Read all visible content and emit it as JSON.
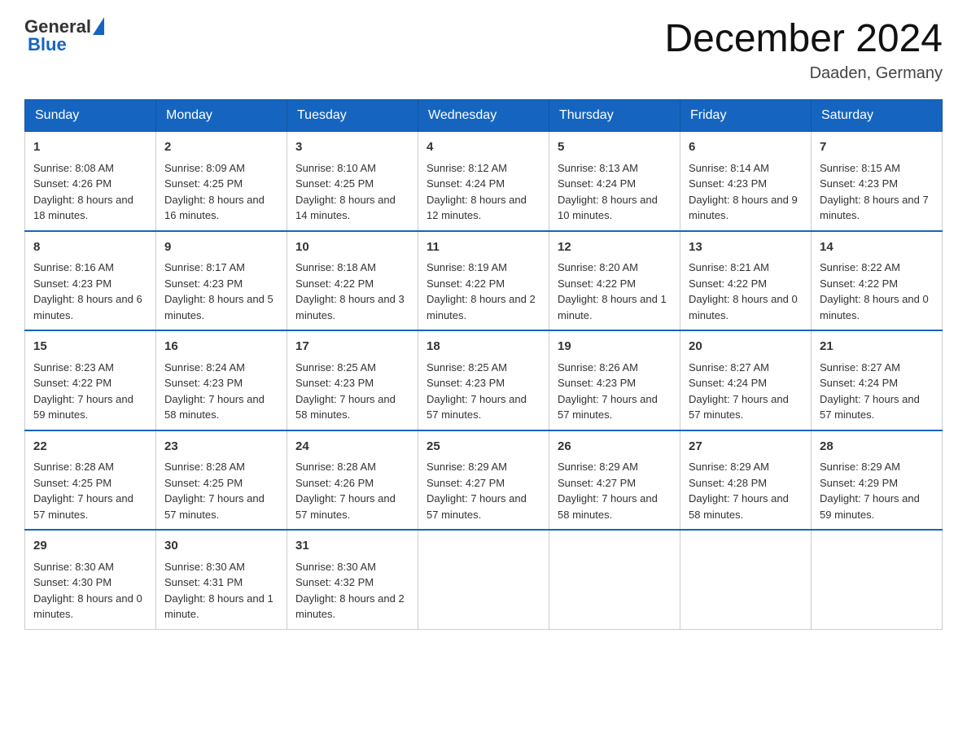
{
  "header": {
    "logo": {
      "general": "General",
      "blue": "Blue"
    },
    "title": "December 2024",
    "location": "Daaden, Germany"
  },
  "weekdays": [
    "Sunday",
    "Monday",
    "Tuesday",
    "Wednesday",
    "Thursday",
    "Friday",
    "Saturday"
  ],
  "weeks": [
    [
      {
        "day": "1",
        "sunrise": "8:08 AM",
        "sunset": "4:26 PM",
        "daylight": "8 hours and 18 minutes."
      },
      {
        "day": "2",
        "sunrise": "8:09 AM",
        "sunset": "4:25 PM",
        "daylight": "8 hours and 16 minutes."
      },
      {
        "day": "3",
        "sunrise": "8:10 AM",
        "sunset": "4:25 PM",
        "daylight": "8 hours and 14 minutes."
      },
      {
        "day": "4",
        "sunrise": "8:12 AM",
        "sunset": "4:24 PM",
        "daylight": "8 hours and 12 minutes."
      },
      {
        "day": "5",
        "sunrise": "8:13 AM",
        "sunset": "4:24 PM",
        "daylight": "8 hours and 10 minutes."
      },
      {
        "day": "6",
        "sunrise": "8:14 AM",
        "sunset": "4:23 PM",
        "daylight": "8 hours and 9 minutes."
      },
      {
        "day": "7",
        "sunrise": "8:15 AM",
        "sunset": "4:23 PM",
        "daylight": "8 hours and 7 minutes."
      }
    ],
    [
      {
        "day": "8",
        "sunrise": "8:16 AM",
        "sunset": "4:23 PM",
        "daylight": "8 hours and 6 minutes."
      },
      {
        "day": "9",
        "sunrise": "8:17 AM",
        "sunset": "4:23 PM",
        "daylight": "8 hours and 5 minutes."
      },
      {
        "day": "10",
        "sunrise": "8:18 AM",
        "sunset": "4:22 PM",
        "daylight": "8 hours and 3 minutes."
      },
      {
        "day": "11",
        "sunrise": "8:19 AM",
        "sunset": "4:22 PM",
        "daylight": "8 hours and 2 minutes."
      },
      {
        "day": "12",
        "sunrise": "8:20 AM",
        "sunset": "4:22 PM",
        "daylight": "8 hours and 1 minute."
      },
      {
        "day": "13",
        "sunrise": "8:21 AM",
        "sunset": "4:22 PM",
        "daylight": "8 hours and 0 minutes."
      },
      {
        "day": "14",
        "sunrise": "8:22 AM",
        "sunset": "4:22 PM",
        "daylight": "8 hours and 0 minutes."
      }
    ],
    [
      {
        "day": "15",
        "sunrise": "8:23 AM",
        "sunset": "4:22 PM",
        "daylight": "7 hours and 59 minutes."
      },
      {
        "day": "16",
        "sunrise": "8:24 AM",
        "sunset": "4:23 PM",
        "daylight": "7 hours and 58 minutes."
      },
      {
        "day": "17",
        "sunrise": "8:25 AM",
        "sunset": "4:23 PM",
        "daylight": "7 hours and 58 minutes."
      },
      {
        "day": "18",
        "sunrise": "8:25 AM",
        "sunset": "4:23 PM",
        "daylight": "7 hours and 57 minutes."
      },
      {
        "day": "19",
        "sunrise": "8:26 AM",
        "sunset": "4:23 PM",
        "daylight": "7 hours and 57 minutes."
      },
      {
        "day": "20",
        "sunrise": "8:27 AM",
        "sunset": "4:24 PM",
        "daylight": "7 hours and 57 minutes."
      },
      {
        "day": "21",
        "sunrise": "8:27 AM",
        "sunset": "4:24 PM",
        "daylight": "7 hours and 57 minutes."
      }
    ],
    [
      {
        "day": "22",
        "sunrise": "8:28 AM",
        "sunset": "4:25 PM",
        "daylight": "7 hours and 57 minutes."
      },
      {
        "day": "23",
        "sunrise": "8:28 AM",
        "sunset": "4:25 PM",
        "daylight": "7 hours and 57 minutes."
      },
      {
        "day": "24",
        "sunrise": "8:28 AM",
        "sunset": "4:26 PM",
        "daylight": "7 hours and 57 minutes."
      },
      {
        "day": "25",
        "sunrise": "8:29 AM",
        "sunset": "4:27 PM",
        "daylight": "7 hours and 57 minutes."
      },
      {
        "day": "26",
        "sunrise": "8:29 AM",
        "sunset": "4:27 PM",
        "daylight": "7 hours and 58 minutes."
      },
      {
        "day": "27",
        "sunrise": "8:29 AM",
        "sunset": "4:28 PM",
        "daylight": "7 hours and 58 minutes."
      },
      {
        "day": "28",
        "sunrise": "8:29 AM",
        "sunset": "4:29 PM",
        "daylight": "7 hours and 59 minutes."
      }
    ],
    [
      {
        "day": "29",
        "sunrise": "8:30 AM",
        "sunset": "4:30 PM",
        "daylight": "8 hours and 0 minutes."
      },
      {
        "day": "30",
        "sunrise": "8:30 AM",
        "sunset": "4:31 PM",
        "daylight": "8 hours and 1 minute."
      },
      {
        "day": "31",
        "sunrise": "8:30 AM",
        "sunset": "4:32 PM",
        "daylight": "8 hours and 2 minutes."
      },
      null,
      null,
      null,
      null
    ]
  ]
}
